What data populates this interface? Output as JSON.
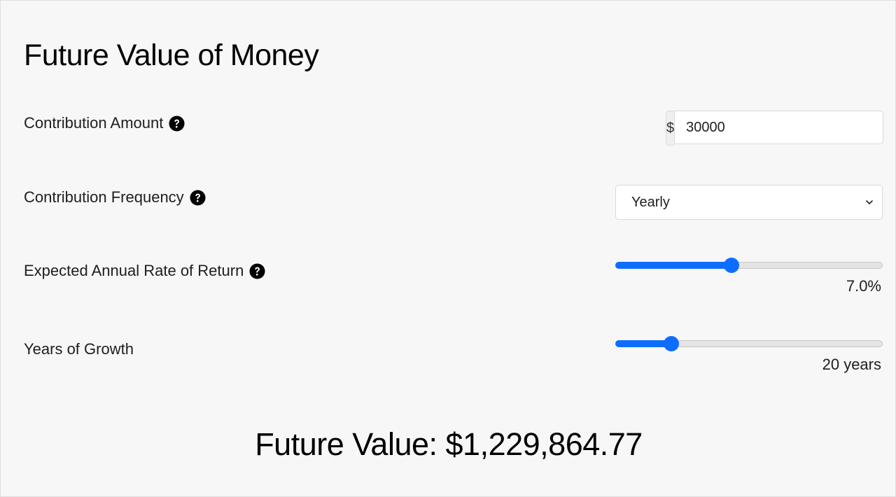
{
  "page": {
    "title": "Future Value of Money"
  },
  "contribution_amount": {
    "label": "Contribution Amount",
    "currency_symbol": "$",
    "value": "30000",
    "help_icon": "question-circle-icon"
  },
  "contribution_frequency": {
    "label": "Contribution Frequency",
    "selected": "Yearly",
    "help_icon": "question-circle-icon",
    "dropdown_icon": "chevron-down-icon"
  },
  "rate_of_return": {
    "label": "Expected Annual Rate of Return",
    "display": "7.0%",
    "fraction": 0.435,
    "help_icon": "question-circle-icon"
  },
  "years_of_growth": {
    "label": "Years of Growth",
    "display": "20 years",
    "fraction": 0.21
  },
  "result": {
    "label": "Future Value:",
    "value": "$1,229,864.77"
  },
  "colors": {
    "accent": "#0d6efd",
    "background": "#f7f7f7",
    "text": "#000000"
  }
}
